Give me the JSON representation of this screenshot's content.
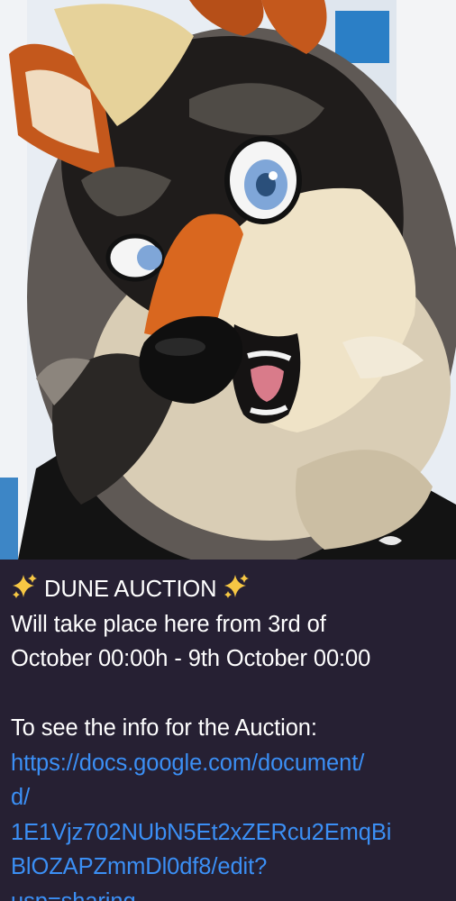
{
  "photo": {
    "subject": "fursuit-head-photo",
    "colors": {
      "sky": "#e9eef4",
      "fur_dark": "#1c1a1a",
      "fur_cream": "#efe3c7",
      "fur_orange": "#d9671f",
      "fur_grey": "#6b6561",
      "eye_blue": "#7fa6d8",
      "nose": "#111111",
      "shirt": "#121212"
    }
  },
  "message": {
    "title": "DUNE AUCTION",
    "title_icon_left": "sparkles-icon",
    "title_icon_right": "sparkles-icon",
    "body_line_1": "Will take place here from 3rd of",
    "body_line_2": "October 00:00h - 9th October 00:00",
    "info_label": "To see the info for the Auction:",
    "link_line_1": "https://docs.google.com/document/",
    "link_line_2": "d/",
    "link_line_3": "1E1Vjz702NUbN5Et2xZERcu2EmqBi",
    "link_line_4": "BlOZAPZmmDl0df8/edit?",
    "link_line_5": "usp=sharing",
    "colors": {
      "background": "#262033",
      "text": "#ffffff",
      "link": "#3b8ff5",
      "sparkle": "#f6c744"
    }
  }
}
